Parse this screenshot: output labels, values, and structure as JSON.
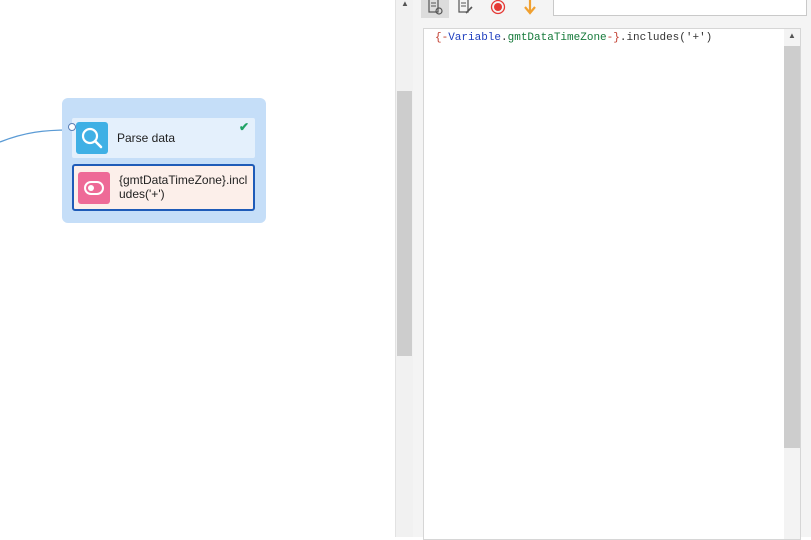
{
  "canvas": {
    "group": {
      "blocks": [
        {
          "label": "Parse data",
          "icon": "search-icon",
          "status": "check-icon"
        },
        {
          "label": "{gmtDataTimeZone}.includes('+')",
          "icon": "toggle-icon"
        }
      ]
    }
  },
  "toolbar": {
    "buttons": [
      {
        "icon": "document-settings-icon",
        "active": true
      },
      {
        "icon": "document-edit-icon",
        "active": false
      },
      {
        "icon": "record-icon",
        "active": false
      },
      {
        "icon": "arrow-down-icon",
        "active": false
      }
    ],
    "search_value": ""
  },
  "editor": {
    "code_tokens": {
      "open": "{-",
      "variable": "Variable",
      "dot": ".",
      "name": "gmtDataTimeZone",
      "close": "-}",
      "rest": ".includes('+')"
    }
  },
  "colors": {
    "group_bg": "#c5def8",
    "parse_icon_bg": "#3fb0e5",
    "condition_icon_bg": "#ee6a97",
    "selection_border": "#1e5bb8",
    "record": "#e53935",
    "arrow": "#f0a030"
  }
}
